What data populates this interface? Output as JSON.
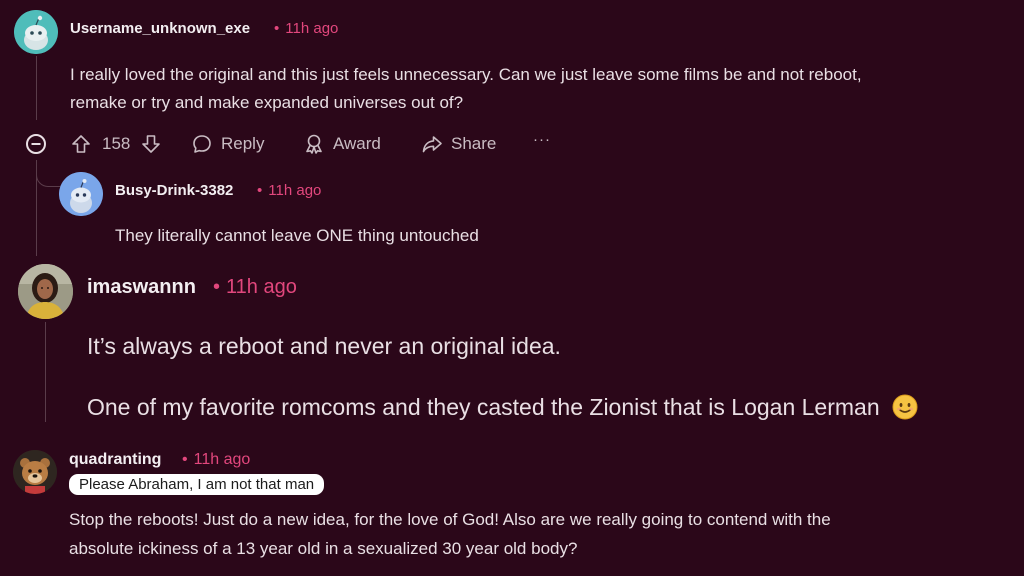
{
  "comments": [
    {
      "username": "Username_unknown_exe",
      "time": "11h ago",
      "avatar_icon": "snoo-avatar-teal",
      "lines": [
        "I really loved the original and this just feels unnecessary. Can we just leave some films be and not reboot,",
        "remake or try and make expanded universes out of?"
      ],
      "actions": {
        "collapse_icon": "minus-circle-icon",
        "upvote_icon": "arrow-up-icon",
        "score": "158",
        "downvote_icon": "arrow-down-icon",
        "reply_label": "Reply",
        "award_label": "Award",
        "share_label": "Share",
        "more_label": "···"
      }
    },
    {
      "username": "Busy-Drink-3382",
      "time": "11h ago",
      "avatar_icon": "snoo-avatar-blue",
      "lines": [
        "They literally cannot leave ONE thing untouched"
      ]
    },
    {
      "username": "imaswannn",
      "time": "11h ago",
      "avatar_icon": "photo-avatar-woman",
      "lines": [
        "It’s always a reboot and never an original idea.",
        "One of my favorite romcoms and they casted the Zionist that is Logan Lerman"
      ],
      "emoji_icon": "slightly-smiling-face-emoji"
    },
    {
      "username": "quadranting",
      "time": "11h ago",
      "avatar_icon": "bear-avatar",
      "flair": "Please Abraham, I am not that man",
      "lines": [
        "Stop the reboots! Just do a new idea, for the love of God! Also are we really going to contend with the",
        "absolute ickiness of a 13 year old in a sexualized 30 year old body?"
      ]
    }
  ],
  "colors": {
    "background": "#2b0719",
    "timestamp": "#e2477d",
    "text": "#e9dfe4",
    "thread_line": "#5a3c4a"
  }
}
